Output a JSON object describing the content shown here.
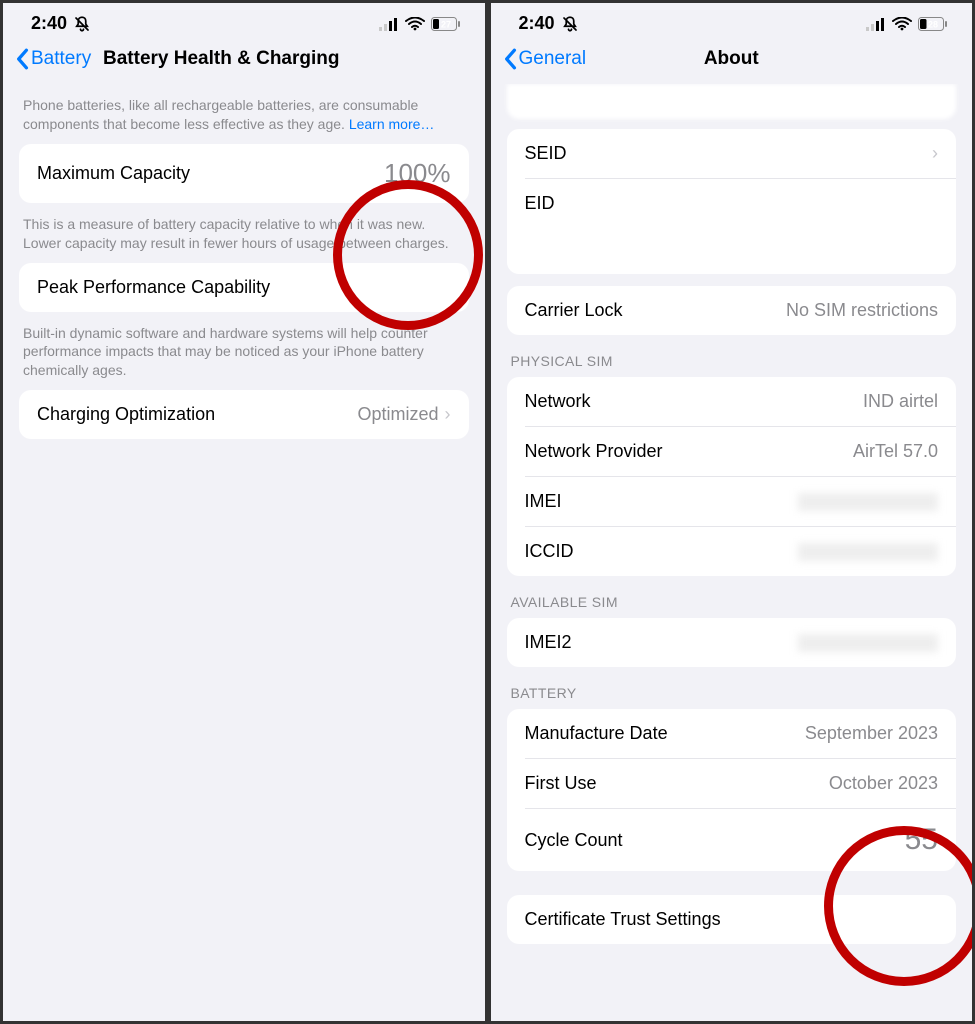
{
  "left": {
    "status": {
      "time": "2:40",
      "battery": "27"
    },
    "nav": {
      "back": "Battery",
      "title": "Battery Health & Charging"
    },
    "intro_a": "Phone batteries, like all rechargeable batteries, are consumable components that become less effective as they age. ",
    "intro_link": "Learn more…",
    "max_capacity": {
      "label": "Maximum Capacity",
      "value": "100%"
    },
    "max_capacity_desc": "This is a measure of battery capacity relative to when it was new. Lower capacity may result in fewer hours of usage between charges.",
    "peak": {
      "label": "Peak Performance Capability"
    },
    "peak_desc": "Built-in dynamic software and hardware systems will help counter performance impacts that may be noticed as your iPhone battery chemically ages.",
    "charging": {
      "label": "Charging Optimization",
      "value": "Optimized"
    }
  },
  "right": {
    "status": {
      "time": "2:40",
      "battery": "28"
    },
    "nav": {
      "back": "General",
      "title": "About"
    },
    "top_rows": [
      {
        "label": "SEID",
        "value": "",
        "chevron": true
      },
      {
        "label": "EID",
        "value": ""
      }
    ],
    "carrier_lock": {
      "label": "Carrier Lock",
      "value": "No SIM restrictions"
    },
    "physical_sim_header": "PHYSICAL SIM",
    "physical_sim": [
      {
        "label": "Network",
        "value": "IND airtel"
      },
      {
        "label": "Network Provider",
        "value": "AirTel 57.0"
      },
      {
        "label": "IMEI",
        "value": ""
      },
      {
        "label": "ICCID",
        "value": ""
      }
    ],
    "available_sim_header": "AVAILABLE SIM",
    "available_sim": [
      {
        "label": "IMEI2",
        "value": ""
      }
    ],
    "battery_header": "BATTERY",
    "battery": [
      {
        "label": "Manufacture Date",
        "value": "September 2023"
      },
      {
        "label": "First Use",
        "value": "October 2023"
      },
      {
        "label": "Cycle Count",
        "value": "55"
      }
    ],
    "cert": {
      "label": "Certificate Trust Settings"
    }
  }
}
